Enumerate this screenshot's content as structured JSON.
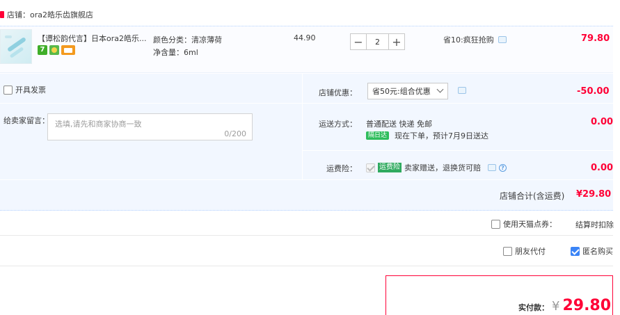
{
  "shop": {
    "label": "店铺：ora2皓乐齿旗舰店"
  },
  "item": {
    "title": "【谭松韵代言】日本ora2皓乐...",
    "spec_color": "颜色分类：清凉薄荷",
    "spec_volume": "净含量：6ml",
    "unit_price": "44.90",
    "quantity": "2",
    "minus": "−",
    "plus": "+",
    "promo": "省10:疯狂抢购",
    "subtotal": "79.80",
    "badges": [
      "7",
      "",
      ""
    ]
  },
  "invoice": {
    "label": "开具发票"
  },
  "message": {
    "label": "给卖家留言：",
    "placeholder": "选填,请先和商家协商一致",
    "counter": "0/200"
  },
  "discount": {
    "label": "店铺优惠：",
    "selected": "省50元:组合优惠",
    "amount": "-50.00"
  },
  "shipping": {
    "label": "运送方式：",
    "method": "普通配送 快递 免邮",
    "tag": "隔日达",
    "eta": "现在下单，预计7月9日送达",
    "amount": "0.00"
  },
  "insurance": {
    "label": "运费险：",
    "tag": "运费险",
    "desc": "卖家赠送，退换货可赔",
    "amount": "0.00"
  },
  "shop_total": {
    "label": "店铺合计(含运费)",
    "amount": "¥29.80"
  },
  "points": {
    "label": "使用天猫点券：",
    "note": "结算时扣除"
  },
  "friend_pay": {
    "label": "朋友代付"
  },
  "anonymous": {
    "label": "匿名购买"
  },
  "payment": {
    "label": "实付款：",
    "currency": "¥",
    "amount": "29.80"
  }
}
